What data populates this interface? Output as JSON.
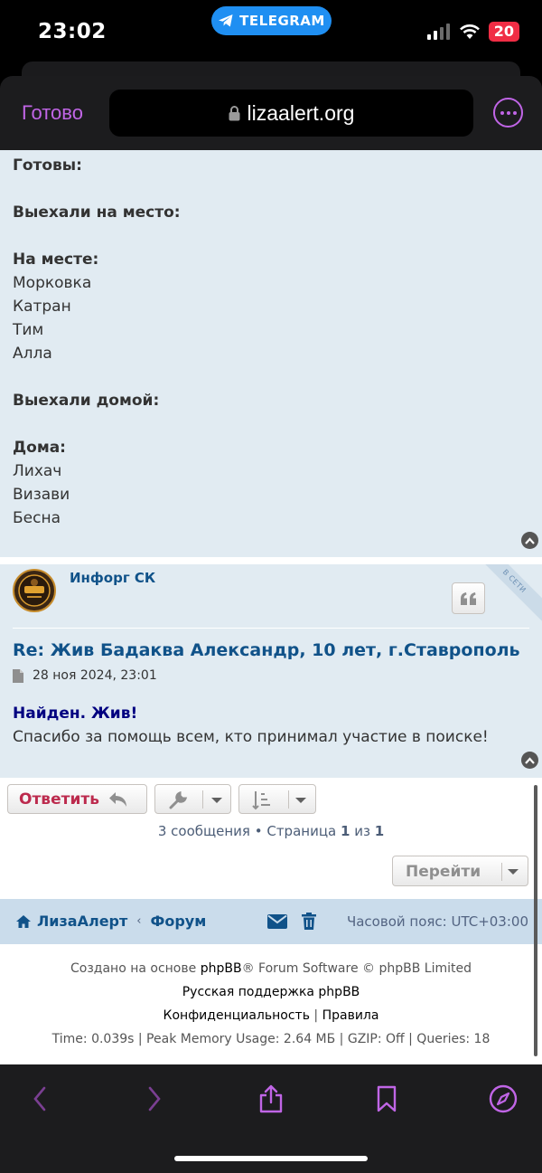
{
  "status_bar": {
    "time": "23:02",
    "back_app": "TELEGRAM",
    "battery": "20"
  },
  "browser": {
    "done_label": "Готово",
    "url": "lizaalert.org"
  },
  "post1": {
    "lines": [
      {
        "text": "Готовы:",
        "bold": true
      },
      {
        "text": "",
        "bold": false
      },
      {
        "text": "Выехали на место:",
        "bold": true
      },
      {
        "text": "",
        "bold": false
      },
      {
        "text": "На месте:",
        "bold": true
      },
      {
        "text": "Морковка",
        "bold": false
      },
      {
        "text": "Катран",
        "bold": false
      },
      {
        "text": "Тим",
        "bold": false
      },
      {
        "text": "Алла",
        "bold": false
      },
      {
        "text": "",
        "bold": false
      },
      {
        "text": "Выехали домой:",
        "bold": true
      },
      {
        "text": "",
        "bold": false
      },
      {
        "text": "Дома:",
        "bold": true
      },
      {
        "text": "Лихач",
        "bold": false
      },
      {
        "text": "Визави",
        "bold": false
      },
      {
        "text": "Бесна",
        "bold": false
      }
    ]
  },
  "post2": {
    "author": "Инфорг СК",
    "online_badge": "В СЕТИ",
    "title": "Re: Жив Бадаква Александр, 10 лет, г.Ставрополь",
    "date": "28 ноя 2024, 23:01",
    "body_highlight": "Найден. Жив!",
    "body_text": "Спасибо за помощь всем, кто принимал участие в поиске!"
  },
  "actions": {
    "reply_label": "Ответить",
    "pagination_prefix": "3 сообщения • Страница ",
    "page_current": "1",
    "page_of": " из ",
    "page_total": "1",
    "goto_label": "Перейти"
  },
  "navbar": {
    "home": "ЛизаАлерт",
    "separator": "‹",
    "forum": "Форум",
    "timezone": "Часовой пояс: UTC+03:00"
  },
  "footer": {
    "line1_prefix": "Создано на основе ",
    "line1_brand": "phpBB",
    "line1_suffix": "® Forum Software © phpBB Limited",
    "line2": "Русская поддержка phpBB",
    "privacy": "Конфиденциальность",
    "sep": " | ",
    "rules": "Правила",
    "stats": "Time: 0.039s | Peak Memory Usage: 2.64 МБ | GZIP: Off | Queries: 18"
  },
  "colors": {
    "accent": "#c065e6",
    "post_bg": "#e1ebf2",
    "link": "#105289",
    "reply": "#bc2a4d",
    "found": "#000080"
  }
}
